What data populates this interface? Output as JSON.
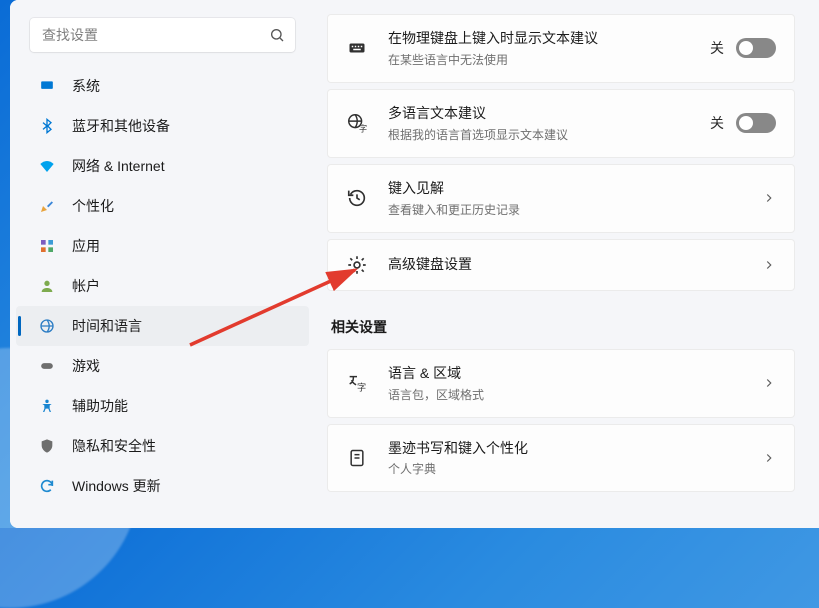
{
  "search": {
    "placeholder": "查找设置"
  },
  "sidebar": {
    "items": [
      {
        "label": "系统",
        "icon": "system"
      },
      {
        "label": "蓝牙和其他设备",
        "icon": "bluetooth"
      },
      {
        "label": "网络 & Internet",
        "icon": "network"
      },
      {
        "label": "个性化",
        "icon": "personalize"
      },
      {
        "label": "应用",
        "icon": "apps"
      },
      {
        "label": "帐户",
        "icon": "account"
      },
      {
        "label": "时间和语言",
        "icon": "time-language",
        "selected": true
      },
      {
        "label": "游戏",
        "icon": "gaming"
      },
      {
        "label": "辅助功能",
        "icon": "accessibility"
      },
      {
        "label": "隐私和安全性",
        "icon": "privacy"
      },
      {
        "label": "Windows 更新",
        "icon": "update"
      }
    ]
  },
  "cards": {
    "physical_kb": {
      "title": "在物理键盘上键入时显示文本建议",
      "sub": "在某些语言中无法使用",
      "toggle": {
        "state_label": "关",
        "on": false
      }
    },
    "multilang": {
      "title": "多语言文本建议",
      "sub": "根据我的语言首选项显示文本建议",
      "toggle": {
        "state_label": "关",
        "on": false
      }
    },
    "typing_insights": {
      "title": "键入见解",
      "sub": "查看键入和更正历史记录"
    },
    "advanced_kb": {
      "title": "高级键盘设置"
    }
  },
  "related_section": {
    "heading": "相关设置"
  },
  "related": {
    "lang_region": {
      "title": "语言 & 区域",
      "sub": "语言包，区域格式"
    },
    "inking": {
      "title": "墨迹书写和键入个性化",
      "sub": "个人字典"
    }
  }
}
